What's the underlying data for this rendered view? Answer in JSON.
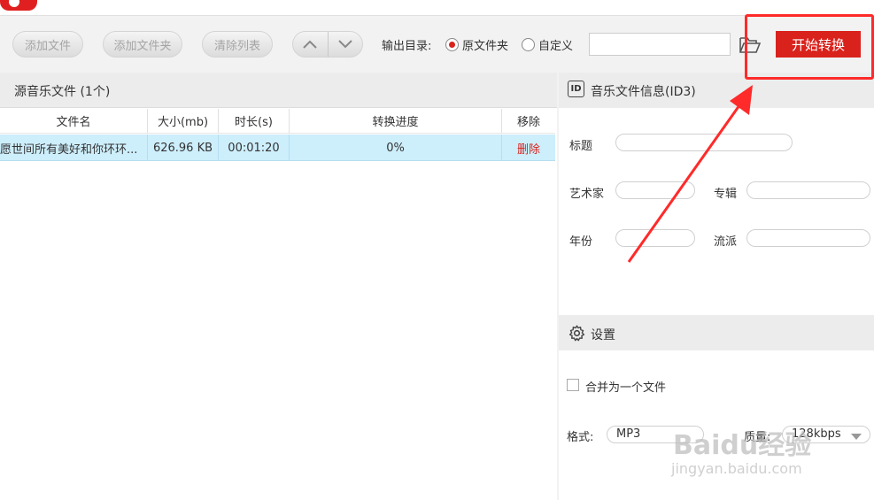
{
  "toolbar": {
    "add_file": "添加文件",
    "add_folder": "添加文件夹",
    "clear_list": "清除列表",
    "output_label": "输出目录:",
    "option_original": "原文件夹",
    "option_custom": "自定义",
    "path_value": "",
    "start_label": "开始转换"
  },
  "file_list": {
    "title": "源音乐文件 (1个)",
    "columns": [
      "文件名",
      "大小(mb)",
      "时长(s)",
      "转换进度",
      "移除"
    ],
    "rows": [
      {
        "name": "愿世间所有美好和你环环...",
        "size": "626.96 KB",
        "duration": "00:01:20",
        "progress": "0%",
        "remove": "删除"
      }
    ]
  },
  "id3": {
    "title": "音乐文件信息(ID3)",
    "badge": "ID",
    "title_label": "标题",
    "artist_label": "艺术家",
    "album_label": "专辑",
    "year_label": "年份",
    "genre_label": "流派"
  },
  "settings": {
    "title": "设置",
    "merge_label": "合并为一个文件",
    "format_label": "格式:",
    "format_value": "MP3",
    "quality_label": "质量:",
    "quality_value": "128kbps"
  },
  "watermark": {
    "main": "Baidu经验",
    "sub": "jingyan.baidu.com"
  },
  "colors": {
    "accent": "#d9221c",
    "selected_row": "#cdeefb",
    "annotation": "#ff2a2a"
  }
}
